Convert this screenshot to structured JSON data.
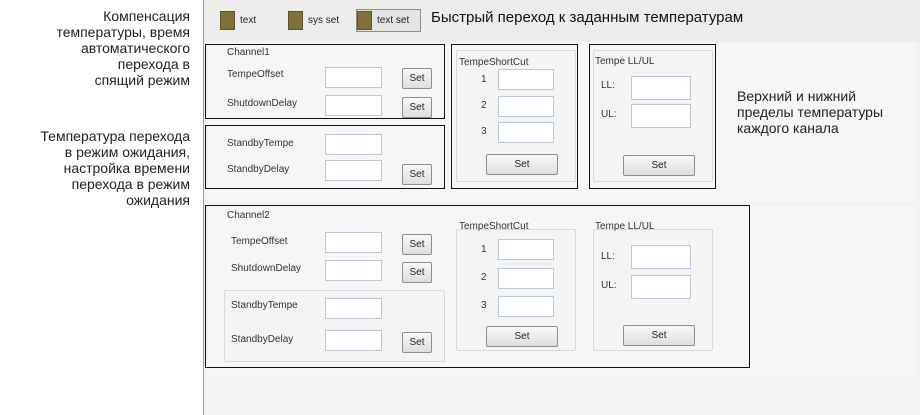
{
  "tabs": [
    {
      "label": "text",
      "color": "#82703a"
    },
    {
      "label": "sys set",
      "color": "#82703a"
    },
    {
      "label": "text set",
      "color": "#82703a",
      "active": true
    }
  ],
  "header_hint": "Быстрый переход к заданным температурам",
  "annotations": {
    "comp_lines": [
      "Компенсация",
      "температуры, время",
      "автоматического",
      "перехода в",
      "спящий режим"
    ],
    "standby_lines": [
      "Температура перехода",
      "в режим ожидания,",
      "настройка времени",
      "перехода в режим",
      "ожидания"
    ],
    "limits_lines": [
      "Верхний и нижний",
      "пределы температуры",
      "каждого канала"
    ]
  },
  "channel1": {
    "title": "Channel1",
    "tempe_offset_label": "TempeOffset",
    "shutdown_delay_label": "ShutdownDelay",
    "standby_tempe_label": "StandbyTempe",
    "standby_delay_label": "StandbyDelay",
    "set_label": "Set",
    "shortcut_title": "TempeShortCut",
    "shortcut_nums": [
      "1",
      "2",
      "3"
    ],
    "limits_title": "Tempe LL/UL",
    "ll_label": "LL:",
    "ul_label": "UL:"
  },
  "channel2": {
    "title": "Channel2",
    "tempe_offset_label": "TempeOffset",
    "shutdown_delay_label": "ShutdownDelay",
    "standby_tempe_label": "StandbyTempe",
    "standby_delay_label": "StandbyDelay",
    "set_label": "Set",
    "shortcut_title": "TempeShortCut",
    "shortcut_nums": [
      "1",
      "2",
      "3"
    ],
    "limits_title": "Tempe LL/UL",
    "ll_label": "LL:",
    "ul_label": "UL:"
  }
}
